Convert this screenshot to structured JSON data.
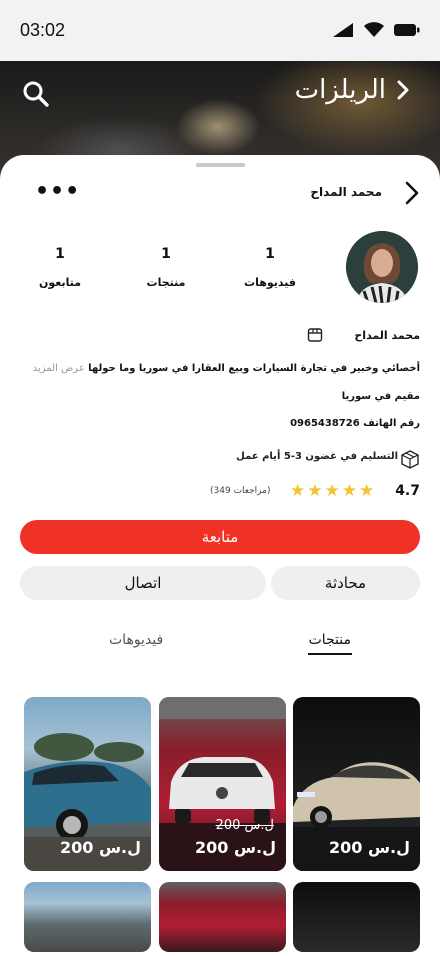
{
  "status": {
    "time": "03:02"
  },
  "hero": {
    "title": "الريلزات"
  },
  "profile": {
    "header_name": "محمد المداح",
    "name": "محمد المداح",
    "stats": [
      {
        "value": "1",
        "label": "فيديوهات"
      },
      {
        "value": "1",
        "label": "منتجات"
      },
      {
        "value": "1",
        "label": "متابعون"
      }
    ],
    "bio": "أخصائي وخبير في تجارة السيارات وبيع العقارا في سوريا وما حولها",
    "bio_more": "عرض المزيد",
    "location": "مقيم في سوريا",
    "phone": "رقم الهاتف 0965438726",
    "delivery": "التسليم في غضون 3-5 أيام عمل",
    "rating": "4.7",
    "rating_stars": 5,
    "reviews": "(349 مراجعات)"
  },
  "actions": {
    "follow": "متابعة",
    "chat": "محادثة",
    "call": "اتصال"
  },
  "tabs": {
    "products": "منتجات",
    "videos": "فيديوهات"
  },
  "products": [
    {
      "price": "200 ل.س",
      "old_price": ""
    },
    {
      "price": "200 ل.س",
      "old_price": "200 ل.س"
    },
    {
      "price": "200 ل.س",
      "old_price": ""
    }
  ],
  "colors": {
    "accent": "#f03226",
    "star": "#f4c430"
  }
}
